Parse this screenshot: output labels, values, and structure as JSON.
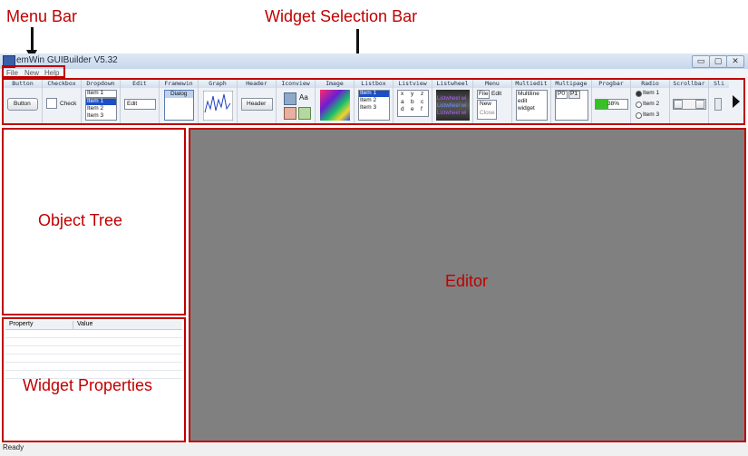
{
  "annotations": {
    "menu_bar": "Menu Bar",
    "widget_selection_bar": "Widget Selection Bar",
    "object_tree": "Object Tree",
    "editor": "Editor",
    "widget_properties": "Widget Properties"
  },
  "window": {
    "title": "emWin GUIBuilder V5.32",
    "controls": {
      "minimize": "▭",
      "maximize": "▢",
      "close": "✕"
    }
  },
  "menu": [
    "File",
    "New",
    "Help"
  ],
  "toolbar": {
    "labels": [
      "Button",
      "Checkbox",
      "Dropdown",
      "Edit",
      "Framewin",
      "Graph",
      "Header",
      "Iconview",
      "Image",
      "Listbox",
      "Listview",
      "Listwheel",
      "Menu",
      "Multiedit",
      "Multipage",
      "Progbar",
      "Radio",
      "Scrollbar",
      "Sli"
    ],
    "button_text": "Button",
    "checkbox_text": "Check",
    "dropdown_selected": "Item 1",
    "dropdown_items": [
      "Item 1",
      "Item 2",
      "Item 3"
    ],
    "edit_text": "Edit",
    "framewin_text": "Dialog",
    "header_text": "Header",
    "iconview_text": "Aa",
    "listbox_items": [
      "Item 1",
      "Item 2",
      "Item 3"
    ],
    "listview_cells": [
      "x",
      "y",
      "z",
      "a",
      "b",
      "c",
      "d",
      "e",
      "f"
    ],
    "listwheel_items": [
      "Listwheel wi",
      "Listwheel wi",
      "Listwheel wi"
    ],
    "menu_items": [
      "File",
      "Edit",
      "New",
      "Close"
    ],
    "multiedit_lines": [
      "Multiline",
      "edit",
      "widget"
    ],
    "multipage_tabs": [
      "P0",
      "P1"
    ],
    "progbar_value": "38%",
    "radio_items": [
      "Item 1",
      "Item 2",
      "Item 3"
    ]
  },
  "properties": {
    "columns": [
      "Property",
      "Value"
    ]
  },
  "status": "Ready",
  "colors": {
    "annotation": "#c00000",
    "editor_bg": "#808080"
  },
  "icons": [
    "app-icon",
    "scroll-right-icon",
    "down-arrow-icon"
  ]
}
